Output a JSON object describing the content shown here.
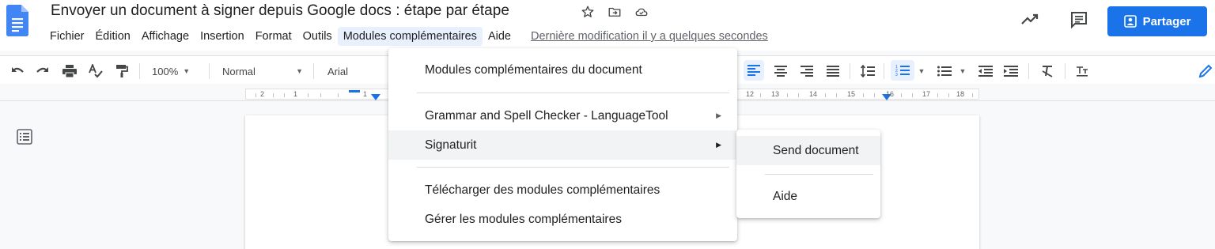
{
  "document": {
    "title": "Envoyer un document à signer depuis Google docs : étape par étape",
    "last_edit": "Dernière modification il y a quelques secondes"
  },
  "menubar": {
    "items": [
      "Fichier",
      "Édition",
      "Affichage",
      "Insertion",
      "Format",
      "Outils",
      "Modules complémentaires",
      "Aide"
    ],
    "active": "Modules complémentaires"
  },
  "share_button": {
    "label": "Partager"
  },
  "toolbar": {
    "zoom": "100%",
    "style": "Normal",
    "font": "Arial"
  },
  "ruler": {
    "labels_left": [
      "2",
      "1",
      "1"
    ],
    "labels_right": [
      "12",
      "13",
      "14",
      "15",
      "16",
      "17",
      "18"
    ]
  },
  "addons_menu": {
    "items": [
      {
        "label": "Modules complémentaires du document",
        "has_submenu": false
      },
      {
        "label": "Grammar and Spell Checker - LanguageTool",
        "has_submenu": true
      },
      {
        "label": "Signaturit",
        "has_submenu": true,
        "highlighted": true
      },
      {
        "label": "Télécharger des modules complémentaires",
        "has_submenu": false
      },
      {
        "label": "Gérer les modules complémentaires",
        "has_submenu": false
      }
    ]
  },
  "signaturit_submenu": {
    "items": [
      {
        "label": "Send document",
        "highlighted": true
      },
      {
        "label": "Aide",
        "highlighted": false
      }
    ]
  },
  "colors": {
    "accent": "#1a73e8",
    "menu_active": "#e8f0fe",
    "hover": "#f1f3f4",
    "docs_blue": "#4285f4"
  }
}
